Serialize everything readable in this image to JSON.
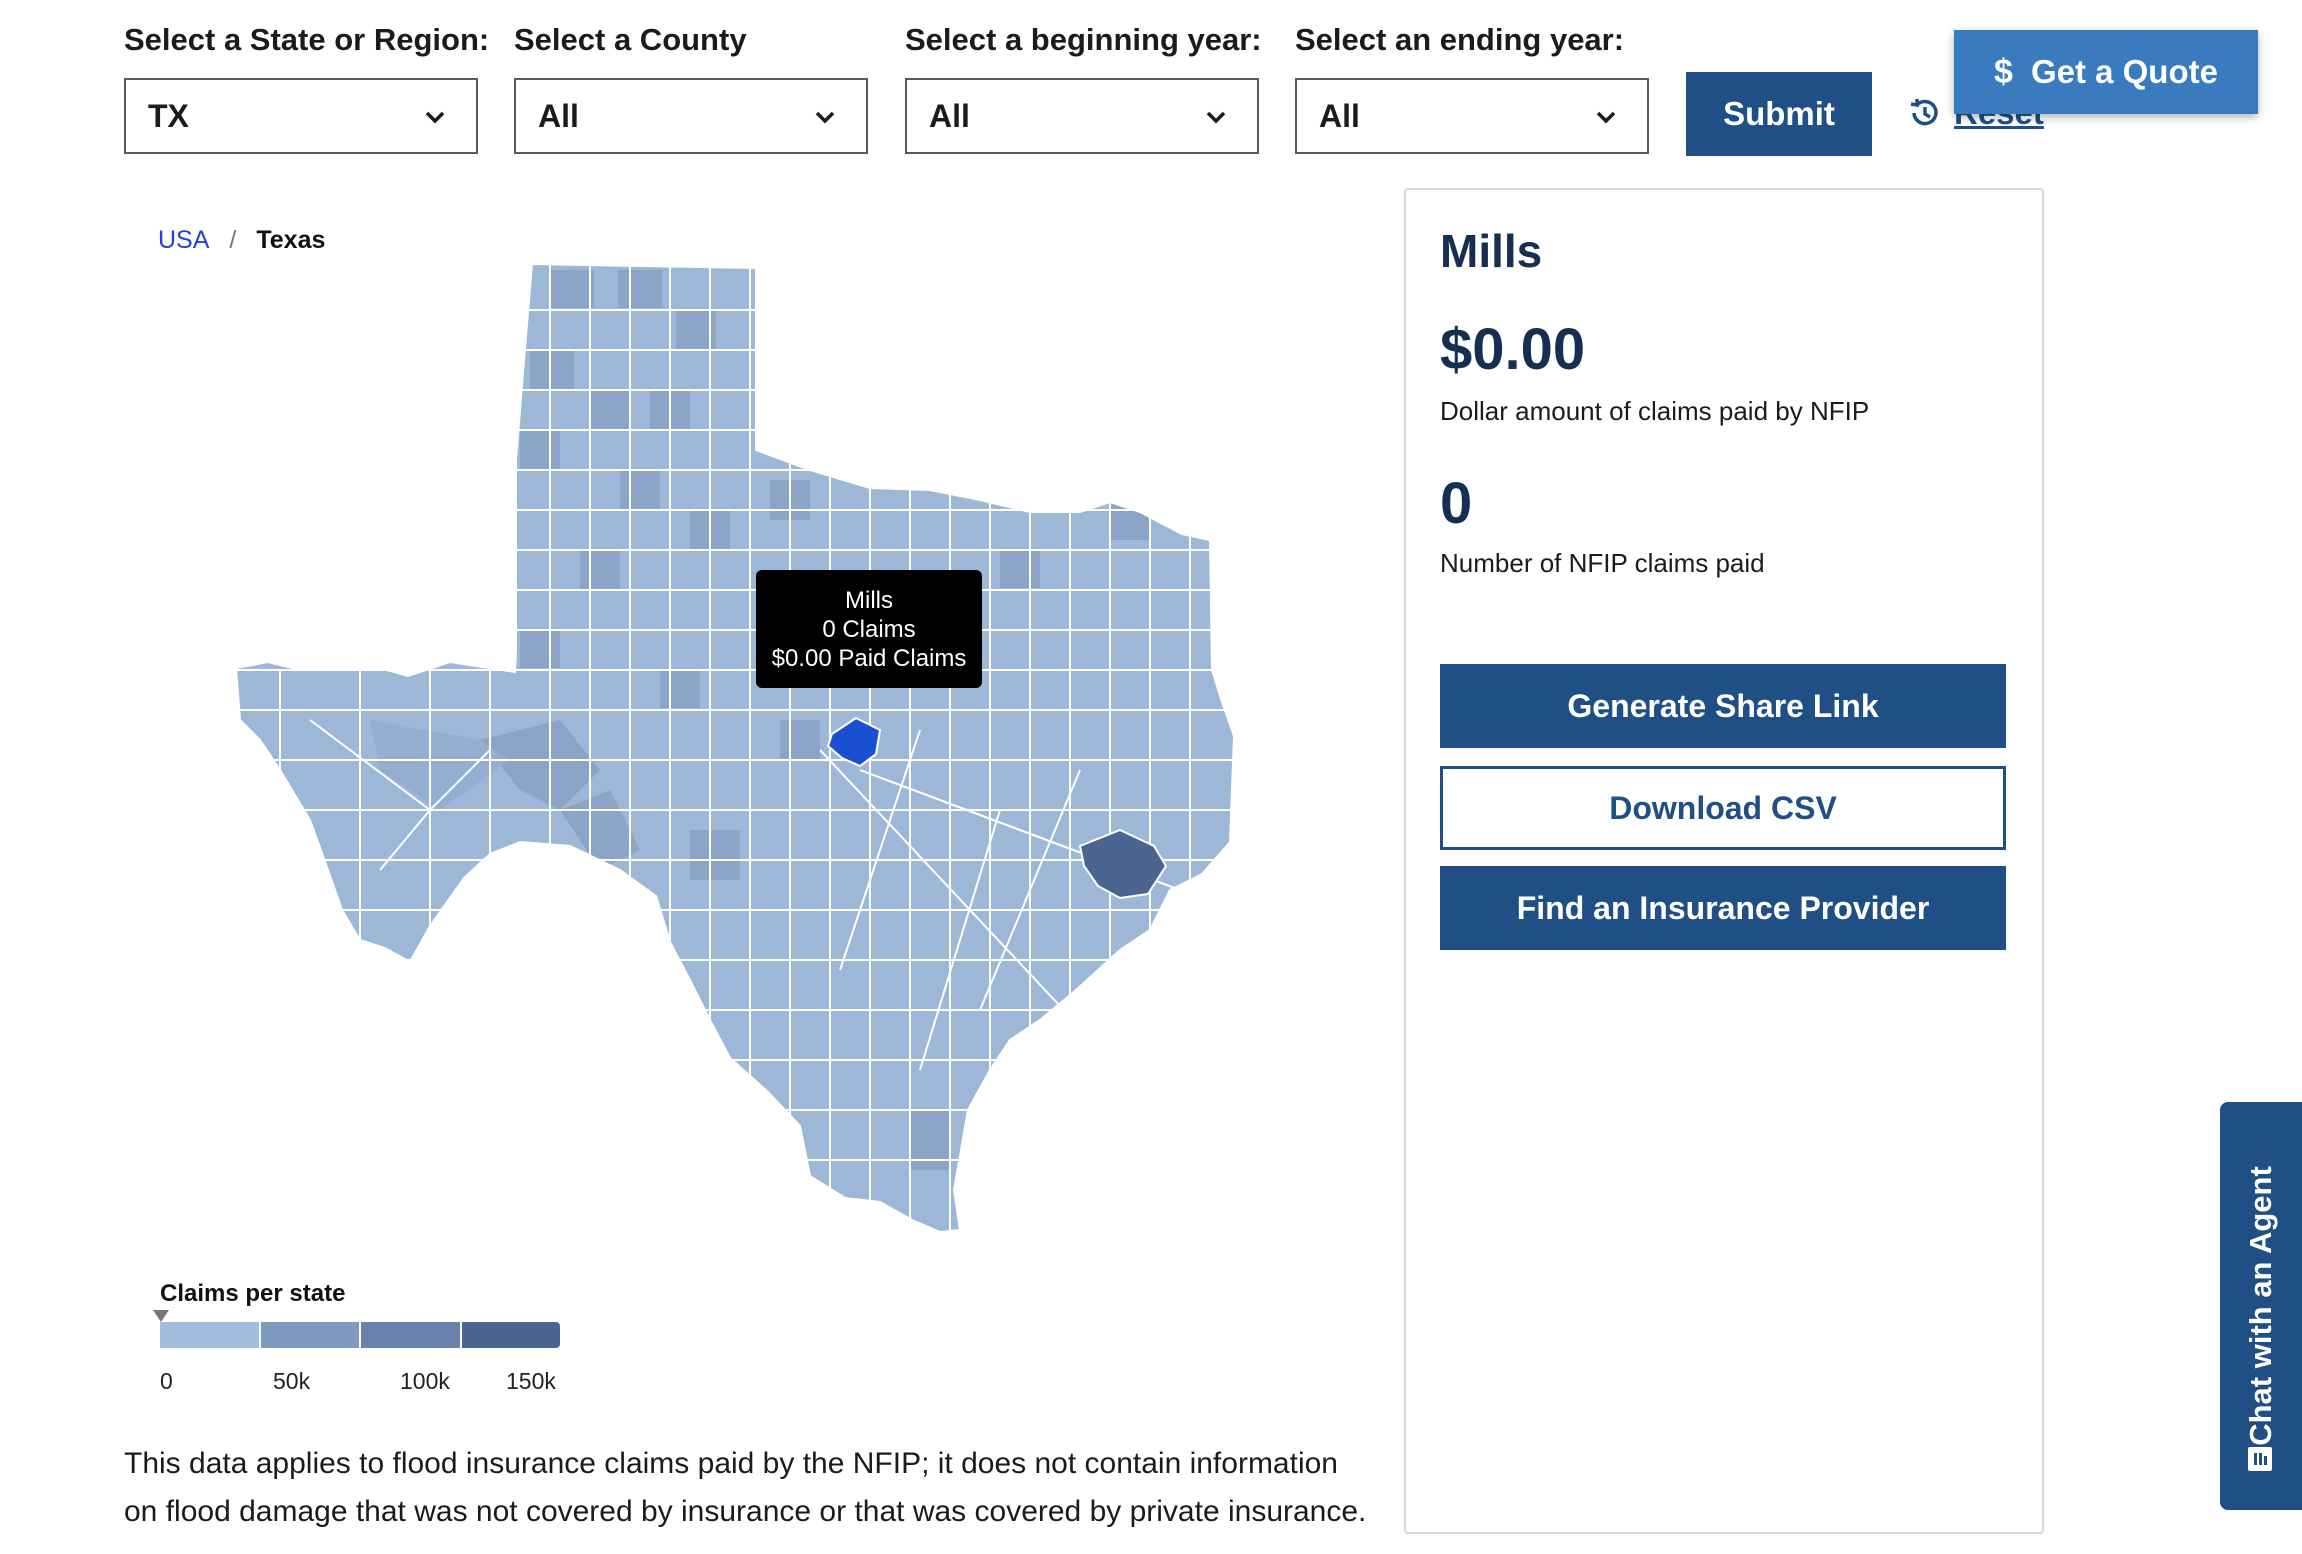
{
  "filters": {
    "state": {
      "label": "Select a State or Region:",
      "value": "TX"
    },
    "county": {
      "label": "Select a County",
      "value": "All"
    },
    "begin_year": {
      "label": "Select a beginning year:",
      "value": "All"
    },
    "end_year": {
      "label": "Select an ending year:",
      "value": "All"
    },
    "submit_label": "Submit",
    "reset_label": "Reset"
  },
  "get_quote_label": "Get a Quote",
  "breadcrumb": {
    "root": "USA",
    "separator": "/",
    "current": "Texas"
  },
  "tooltip": {
    "county": "Mills",
    "claims": "0 Claims",
    "paid": "$0.00 Paid Claims"
  },
  "legend": {
    "title": "Claims per state",
    "ticks": [
      "0",
      "50k",
      "100k",
      "150k"
    ],
    "colors": [
      "#a3bddf",
      "#7f9ac0",
      "#6982ad",
      "#4a6590"
    ]
  },
  "disclaimer": "This data applies to flood insurance claims paid by the NFIP; it does not contain information on flood damage that was not covered by insurance or that was covered by private insurance.",
  "panel": {
    "county_name": "Mills",
    "dollar_amount": "$0.00",
    "dollar_caption": "Dollar amount of claims paid by NFIP",
    "claims_count": "0",
    "claims_caption": "Number of NFIP claims paid",
    "share_label": "Generate Share Link",
    "csv_label": "Download CSV",
    "provider_label": "Find an Insurance Provider"
  },
  "chat_label": "Chat with an Agent",
  "colors": {
    "primary": "#1f4f85",
    "county_default": "#9db7d6",
    "county_selected": "#1a4fd1",
    "county_high": "#4a6590"
  }
}
